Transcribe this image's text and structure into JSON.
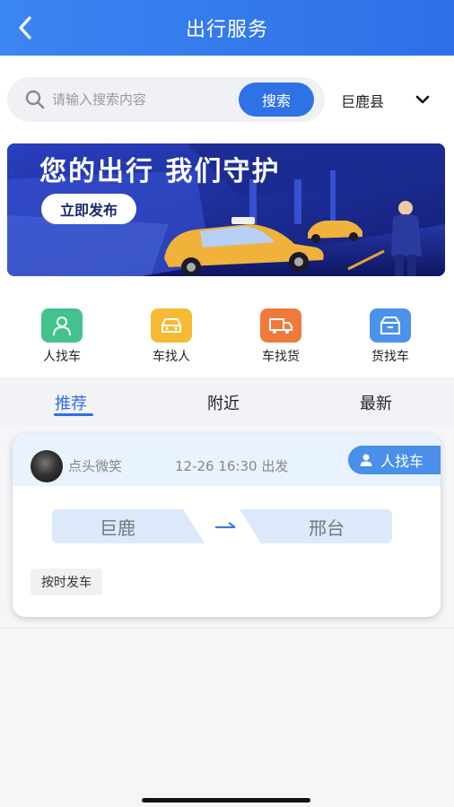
{
  "header": {
    "title": "出行服务",
    "back_icon": "chevron-left-icon"
  },
  "search": {
    "placeholder": "请输入搜索内容",
    "button_label": "搜索",
    "icon": "search-icon"
  },
  "region": {
    "name": "巨鹿县",
    "icon": "chevron-down-icon"
  },
  "banner": {
    "title": "您的出行 我们守护",
    "button_label": "立即发布"
  },
  "categories": [
    {
      "label": "人找车",
      "icon": "person-icon",
      "color": "#3fbf8a"
    },
    {
      "label": "车找人",
      "icon": "car-icon",
      "color": "#f5b82e"
    },
    {
      "label": "车找货",
      "icon": "truck-icon",
      "color": "#f07a3c"
    },
    {
      "label": "货找车",
      "icon": "box-icon",
      "color": "#4a8fe8"
    }
  ],
  "tabs": [
    {
      "label": "推荐",
      "active": true
    },
    {
      "label": "附近",
      "active": false
    },
    {
      "label": "最新",
      "active": false
    }
  ],
  "listing": {
    "username": "点头微笑",
    "depart_time": "12-26 16:30 出发",
    "badge": "人找车",
    "from": "巨鹿",
    "to": "邢台",
    "tag": "按时发车"
  },
  "colors": {
    "accent": "#2f6fe6",
    "card_header": "#e9f2ff",
    "route_bg": "#dbe9fb"
  }
}
